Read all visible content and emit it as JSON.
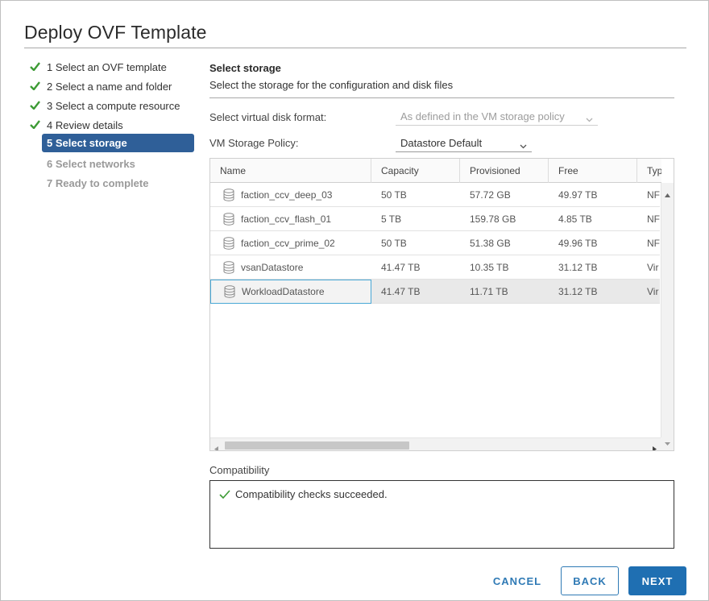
{
  "dialog": {
    "title": "Deploy OVF Template"
  },
  "steps": [
    {
      "label": "1 Select an OVF template",
      "state": "done"
    },
    {
      "label": "2 Select a name and folder",
      "state": "done"
    },
    {
      "label": "3 Select a compute resource",
      "state": "done"
    },
    {
      "label": "4 Review details",
      "state": "done"
    },
    {
      "label": "5 Select storage",
      "state": "active"
    },
    {
      "label": "6 Select networks",
      "state": "pending"
    },
    {
      "label": "7 Ready to complete",
      "state": "pending"
    }
  ],
  "section": {
    "title": "Select storage",
    "subtitle": "Select the storage for the configuration and disk files"
  },
  "fields": {
    "disk_format_label": "Select virtual disk format:",
    "disk_format_value": "As defined in the VM storage policy",
    "storage_policy_label": "VM Storage Policy:",
    "storage_policy_value": "Datastore Default"
  },
  "grid": {
    "columns": [
      "Name",
      "Capacity",
      "Provisioned",
      "Free",
      "Typ"
    ],
    "rows": [
      {
        "name": "faction_ccv_deep_03",
        "capacity": "50 TB",
        "provisioned": "57.72 GB",
        "free": "49.97 TB",
        "type": "NF"
      },
      {
        "name": "faction_ccv_flash_01",
        "capacity": "5 TB",
        "provisioned": "159.78 GB",
        "free": "4.85 TB",
        "type": "NF"
      },
      {
        "name": "faction_ccv_prime_02",
        "capacity": "50 TB",
        "provisioned": "51.38 GB",
        "free": "49.96 TB",
        "type": "NF"
      },
      {
        "name": "vsanDatastore",
        "capacity": "41.47 TB",
        "provisioned": "10.35 TB",
        "free": "31.12 TB",
        "type": "Vir"
      },
      {
        "name": "WorkloadDatastore",
        "capacity": "41.47 TB",
        "provisioned": "11.71 TB",
        "free": "31.12 TB",
        "type": "Vir"
      }
    ],
    "selected_row": 4
  },
  "compatibility": {
    "label": "Compatibility",
    "message": "Compatibility checks succeeded."
  },
  "buttons": {
    "cancel": "CANCEL",
    "back": "BACK",
    "next": "NEXT"
  },
  "colors": {
    "accent": "#2f5f98",
    "primary_button": "#1f6fb2",
    "check": "#3d9b35",
    "selection_border": "#49a8d6"
  },
  "icons": {
    "step_done": "check-icon",
    "datastore": "database-icon",
    "compat_ok": "check-icon"
  }
}
